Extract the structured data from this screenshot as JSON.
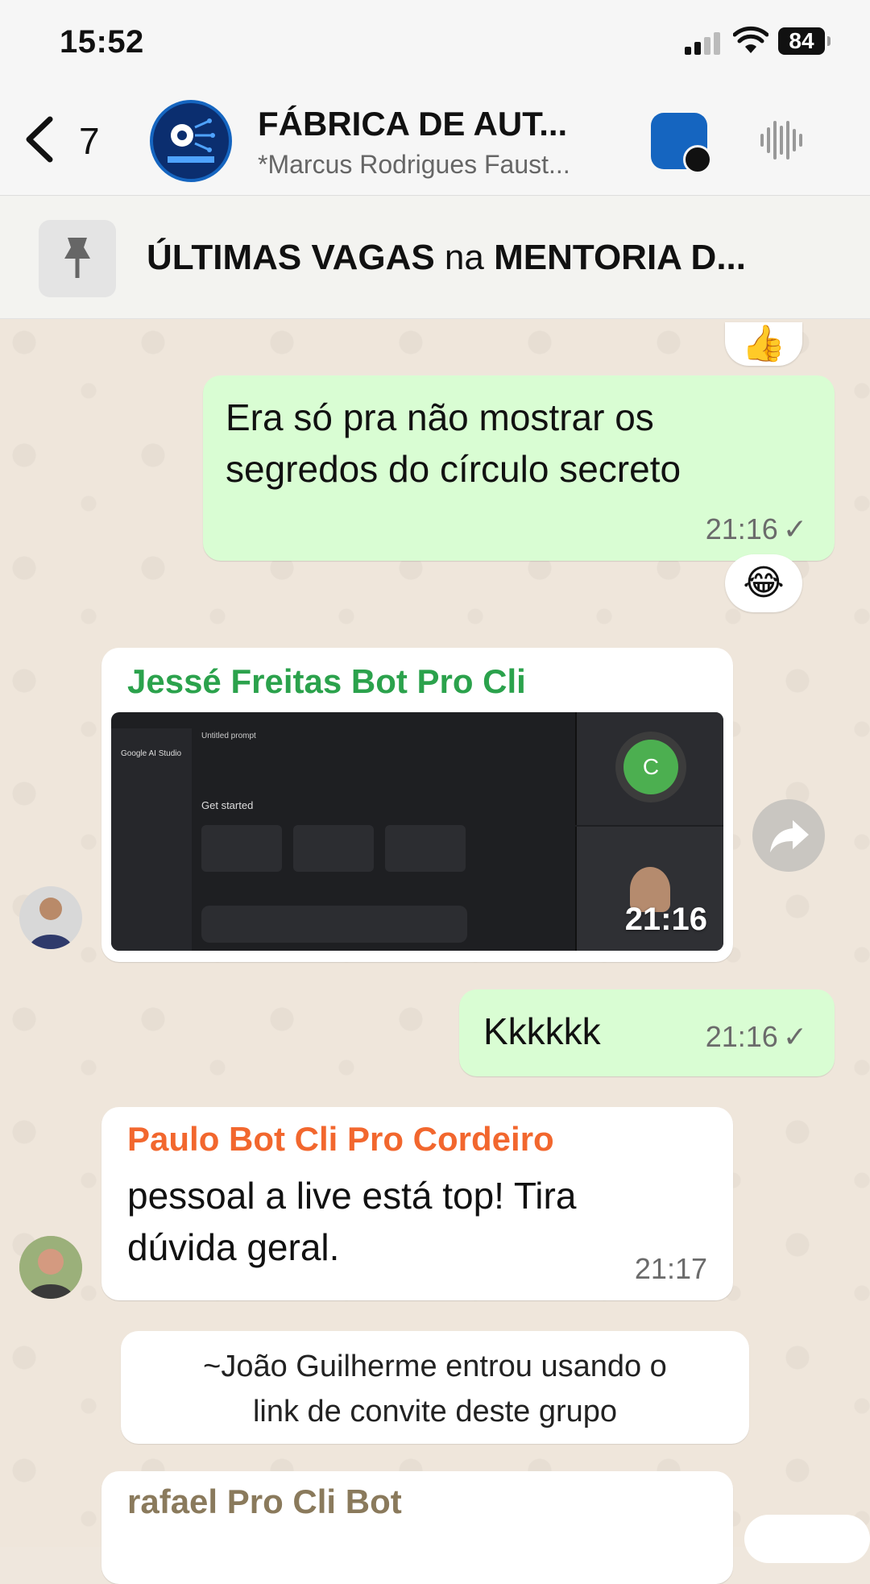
{
  "status_bar": {
    "time": "15:52",
    "battery": "84"
  },
  "header": {
    "back_count": "7",
    "title": "FÁBRICA DE AUT...",
    "subtitle": "*Marcus Rodrigues Faust..."
  },
  "pinned": {
    "bold1": "ÚLTIMAS VAGAS",
    "normal": " na ",
    "bold2": "MENTORIA D..."
  },
  "messages": [
    {
      "type": "reaction",
      "emoji": "👍"
    },
    {
      "type": "outgoing",
      "text_line1": "Era só pra não mostrar os",
      "text_line2": "segredos do círculo secreto",
      "time": "21:16",
      "status": "✓"
    },
    {
      "type": "reaction",
      "emoji": "😂"
    },
    {
      "type": "incoming_image",
      "sender": "Jessé Freitas Bot Pro Cli",
      "sender_color": "#2ba24c",
      "time": "21:16",
      "image": {
        "app_label": "Google AI Studio",
        "tab_title": "Untitled prompt",
        "heading": "Get started",
        "avatar_letter": "C"
      }
    },
    {
      "type": "outgoing",
      "text": "Kkkkkk",
      "time": "21:16",
      "status": "✓"
    },
    {
      "type": "incoming",
      "sender": "Paulo Bot Cli Pro Cordeiro",
      "sender_color": "#f2672e",
      "text_line1": "pessoal a live está top! Tira",
      "text_line2": "dúvida geral.",
      "time": "21:17"
    },
    {
      "type": "system",
      "line1": "~João Guilherme entrou usando o",
      "line2": "link de convite deste grupo"
    },
    {
      "type": "incoming_partial",
      "sender": "rafael Pro Cli Bot",
      "sender_color": "#8a7a5c"
    }
  ],
  "colors": {
    "outgoing_bubble": "#d9fdd3",
    "incoming_bubble": "#ffffff",
    "chat_bg": "#efe6db"
  }
}
